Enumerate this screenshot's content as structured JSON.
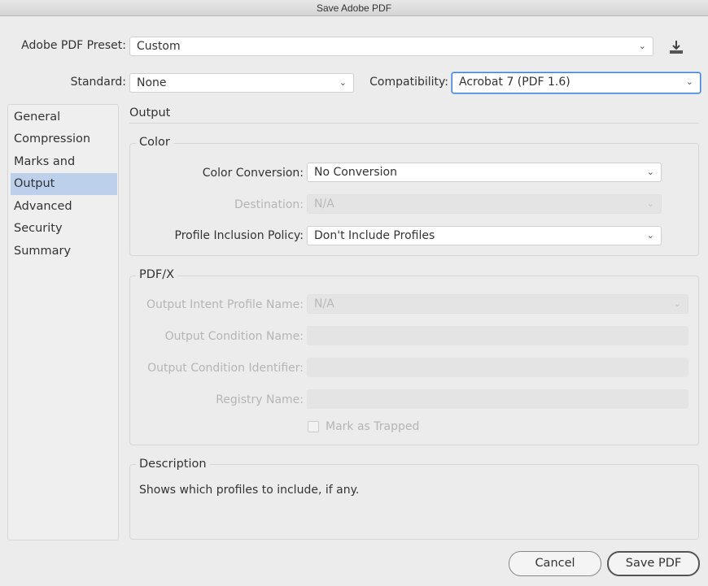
{
  "window": {
    "title": "Save Adobe PDF"
  },
  "header": {
    "preset_label": "Adobe PDF Preset:",
    "preset_value": "Custom",
    "standard_label": "Standard:",
    "standard_value": "None",
    "compat_label": "Compatibility:",
    "compat_value": "Acrobat 7 (PDF 1.6)"
  },
  "sidebar": {
    "items": [
      {
        "label": "General"
      },
      {
        "label": "Compression"
      },
      {
        "label": "Marks and Bleeds"
      },
      {
        "label": "Output"
      },
      {
        "label": "Advanced"
      },
      {
        "label": "Security"
      },
      {
        "label": "Summary"
      }
    ]
  },
  "main": {
    "section_title": "Output",
    "color": {
      "legend": "Color",
      "conv_label": "Color Conversion:",
      "conv_value": "No Conversion",
      "dest_label": "Destination:",
      "dest_value": "N/A",
      "policy_label": "Profile Inclusion Policy:",
      "policy_value": "Don't Include Profiles"
    },
    "pdfx": {
      "legend": "PDF/X",
      "intent_label": "Output Intent Profile Name:",
      "intent_value": "N/A",
      "cond_name_label": "Output Condition Name:",
      "cond_id_label": "Output Condition Identifier:",
      "registry_label": "Registry Name:",
      "trapped_label": "Mark as Trapped"
    },
    "description": {
      "legend": "Description",
      "text": "Shows which profiles to include, if any."
    }
  },
  "footer": {
    "cancel": "Cancel",
    "save": "Save PDF"
  }
}
